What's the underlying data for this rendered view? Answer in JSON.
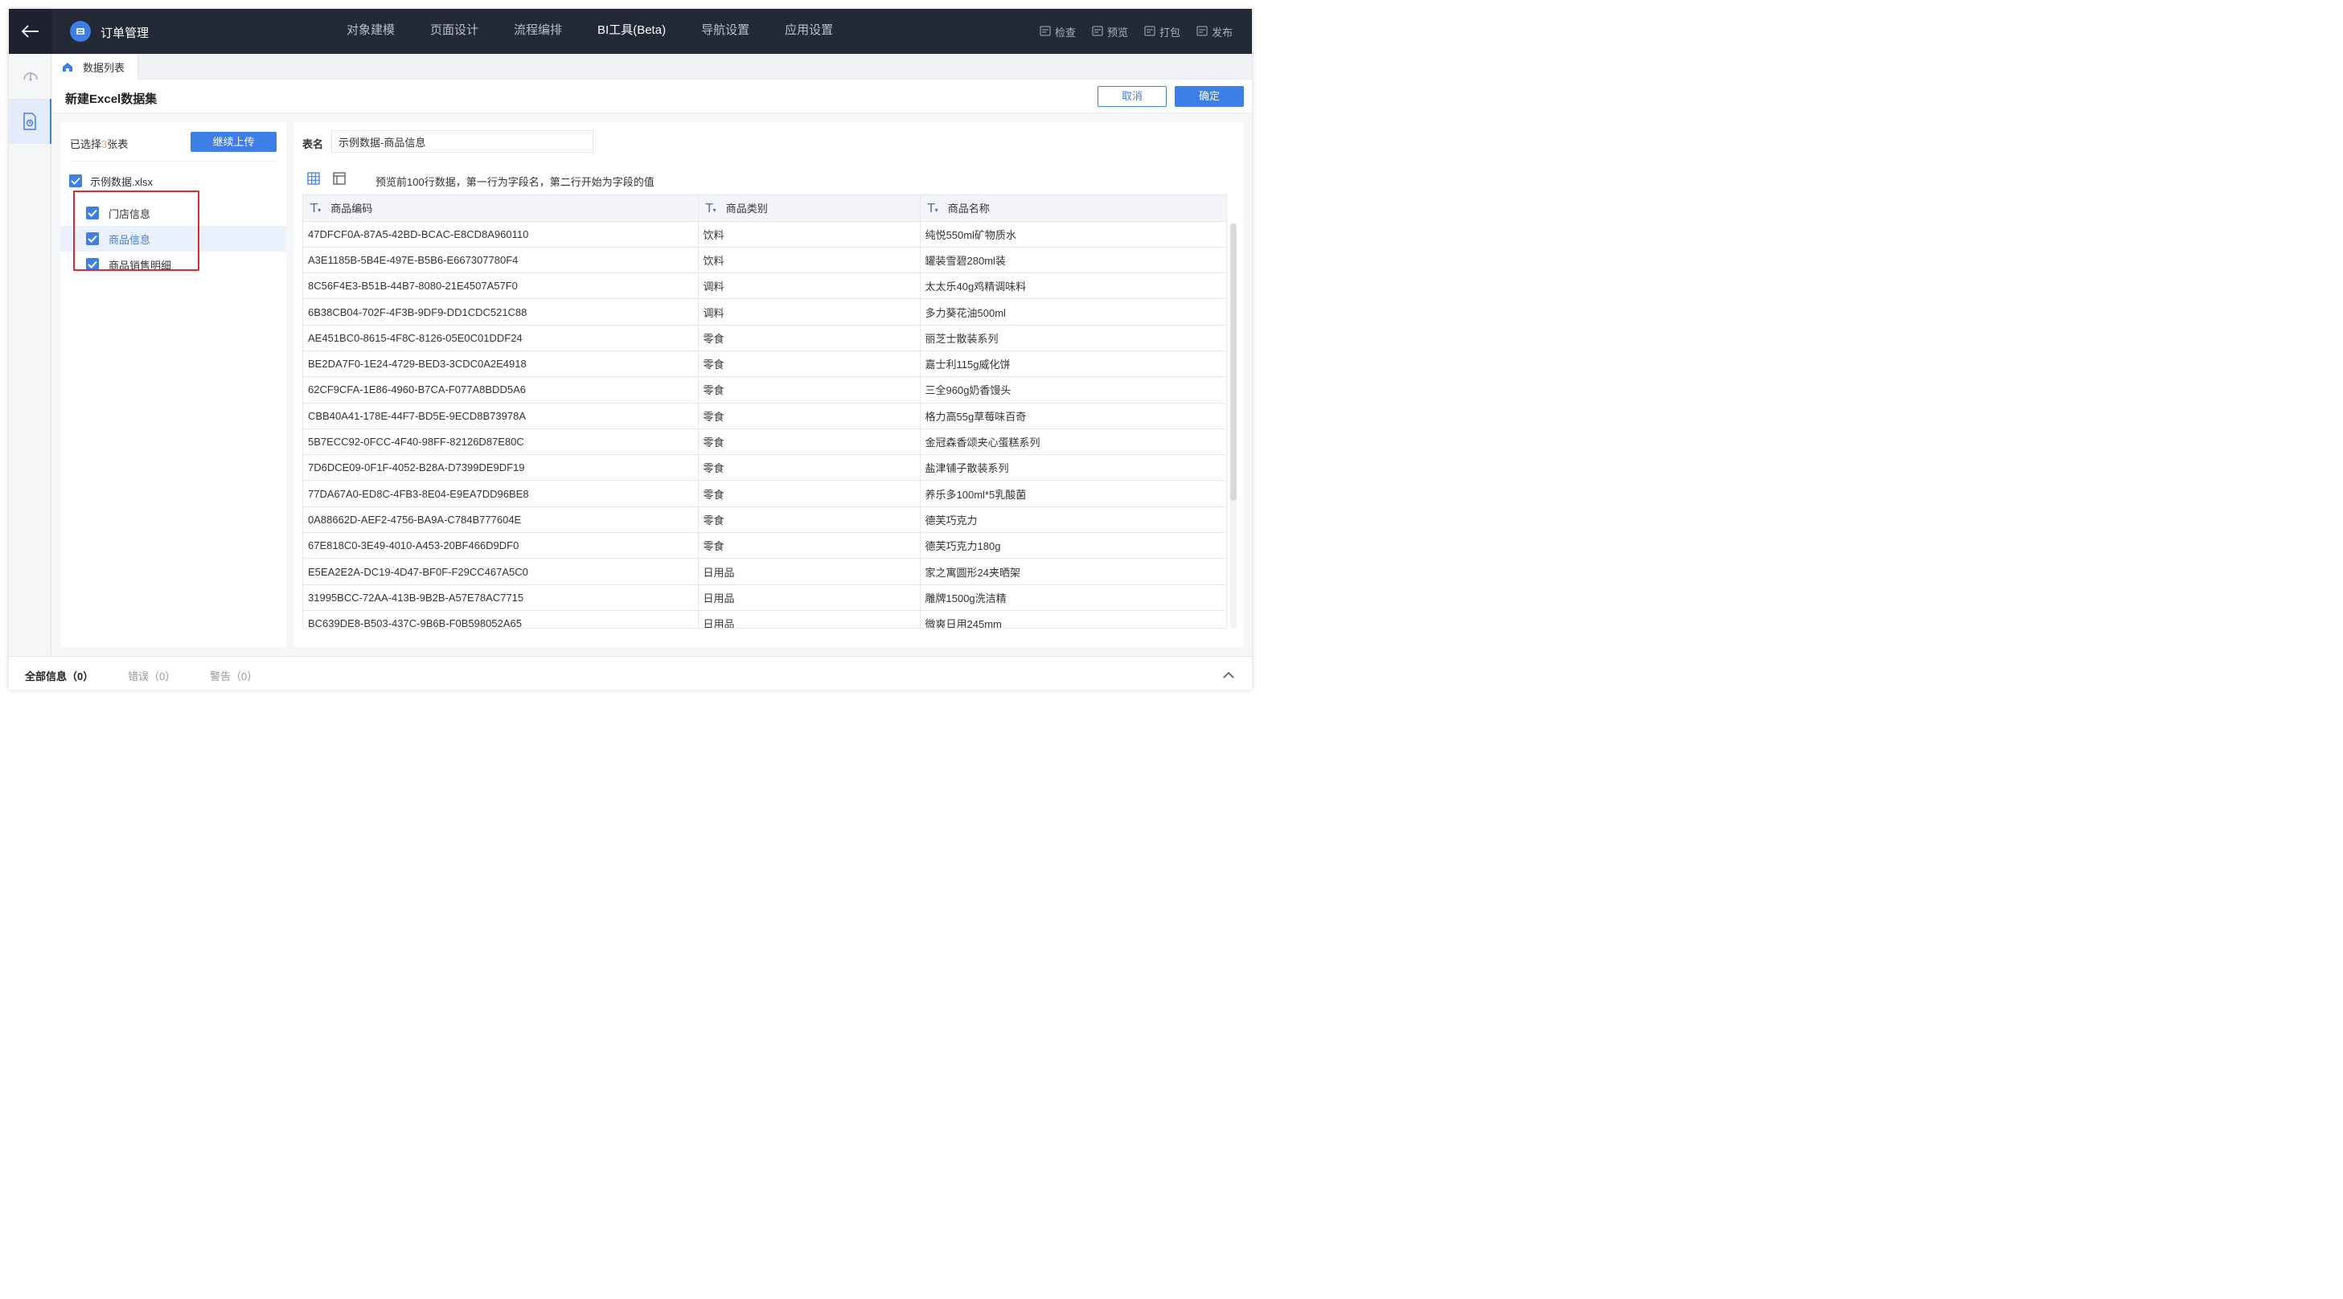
{
  "app": {
    "title": "订单管理"
  },
  "nav": [
    "对象建模",
    "页面设计",
    "流程编排",
    "BI工具(Beta)",
    "导航设置",
    "应用设置"
  ],
  "actions": [
    "检查",
    "预览",
    "打包",
    "发布"
  ],
  "tab": {
    "label": "数据列表"
  },
  "header": {
    "title": "新建Excel数据集",
    "cancel": "取消",
    "ok": "确定"
  },
  "left": {
    "selected_prefix": "已选择",
    "selected_num": "3",
    "selected_suffix": "张表",
    "upload_label": "继续上传",
    "file_name": "示例数据.xlsx",
    "sheets": [
      "门店信息",
      "商品信息",
      "商品销售明细"
    ]
  },
  "right": {
    "name_label": "表名",
    "name_value": "示例数据-商品信息",
    "hint": "预览前100行数据，第一行为字段名，第二行开始为字段的值",
    "columns": [
      "商品编码",
      "商品类别",
      "商品名称"
    ],
    "rows": [
      [
        "47DFCF0A-87A5-42BD-BCAC-E8CD8A960110",
        "饮料",
        "纯悦550ml矿物质水"
      ],
      [
        "A3E1185B-5B4E-497E-B5B6-E667307780F4",
        "饮料",
        "罐装雪碧280ml装"
      ],
      [
        "8C56F4E3-B51B-44B7-8080-21E4507A57F0",
        "调料",
        "太太乐40g鸡精调味料"
      ],
      [
        "6B38CB04-702F-4F3B-9DF9-DD1CDC521C88",
        "调料",
        "多力葵花油500ml"
      ],
      [
        "AE451BC0-8615-4F8C-8126-05E0C01DDF24",
        "零食",
        "丽芝士散装系列"
      ],
      [
        "BE2DA7F0-1E24-4729-BED3-3CDC0A2E4918",
        "零食",
        "嘉士利115g威化饼"
      ],
      [
        "62CF9CFA-1E86-4960-B7CA-F077A8BDD5A6",
        "零食",
        "三全960g奶香馒头"
      ],
      [
        "CBB40A41-178E-44F7-BD5E-9ECD8B73978A",
        "零食",
        "格力高55g草莓味百奇"
      ],
      [
        "5B7ECC92-0FCC-4F40-98FF-82126D87E80C",
        "零食",
        "金冠森香颂夹心蛋糕系列"
      ],
      [
        "7D6DCE09-0F1F-4052-B28A-D7399DE9DF19",
        "零食",
        "盐津铺子散装系列"
      ],
      [
        "77DA67A0-ED8C-4FB3-8E04-E9EA7DD96BE8",
        "零食",
        "养乐多100ml*5乳酸菌"
      ],
      [
        "0A88662D-AEF2-4756-BA9A-C784B777604E",
        "零食",
        "德芙巧克力"
      ],
      [
        "67E818C0-3E49-4010-A453-20BF466D9DF0",
        "零食",
        "德芙巧克力180g"
      ],
      [
        "E5EA2E2A-DC19-4D47-BF0F-F29CC467A5C0",
        "日用品",
        "家之寓圆形24夹晒架"
      ],
      [
        "31995BCC-72AA-413B-9B2B-A57E78AC7715",
        "日用品",
        "雕牌1500g洗洁精"
      ],
      [
        "BC639DE8-B503-437C-9B6B-F0B598052A65",
        "日用品",
        "微爽日用245mm"
      ]
    ]
  },
  "bottom": [
    "全部信息（0）",
    "错误（0）",
    "警告（0）"
  ],
  "colors": {
    "primary": "#3e7ee8",
    "topbar": "#242938",
    "highlight": "#e02a2a",
    "count": "#f5a623"
  }
}
